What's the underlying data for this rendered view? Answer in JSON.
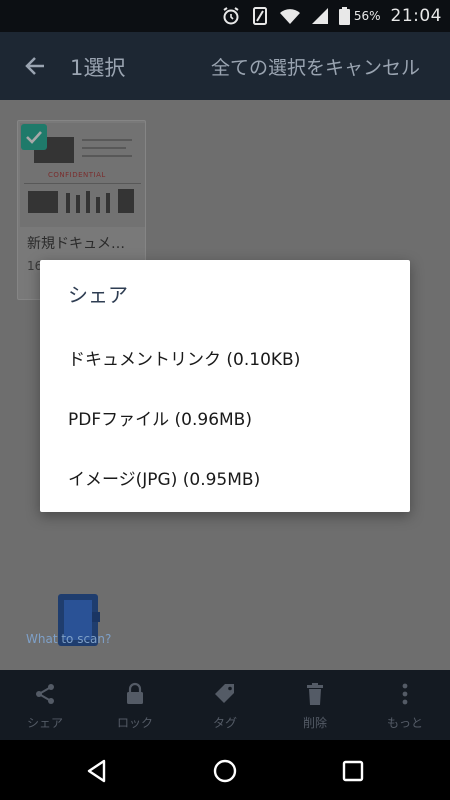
{
  "status_bar": {
    "battery_percent": "56%",
    "time": "21:04",
    "icons": [
      "alarm-icon",
      "vibrate-icon",
      "wifi-icon",
      "signal-icon",
      "battery-icon"
    ]
  },
  "app_bar": {
    "selection_count": "1選択",
    "cancel_all_label": "全ての選択をキャンセル"
  },
  "document": {
    "title": "新規ドキュメ…",
    "date": "16",
    "thumbnail_text": "CONFIDENTIAL"
  },
  "helper": {
    "label": "What to scan?"
  },
  "share_dialog": {
    "title": "シェア",
    "options": [
      "ドキュメントリンク (0.10KB)",
      "PDFファイル (0.96MB)",
      "イメージ(JPG) (0.95MB)"
    ]
  },
  "toolbar": {
    "items": [
      {
        "label": "シェア",
        "icon": "share-icon"
      },
      {
        "label": "ロック",
        "icon": "lock-icon"
      },
      {
        "label": "タグ",
        "icon": "tag-icon"
      },
      {
        "label": "削除",
        "icon": "trash-icon"
      },
      {
        "label": "もっと",
        "icon": "more-vert-icon"
      }
    ]
  },
  "colors": {
    "app_bar": "#1d2733",
    "dialog_title": "#2e3d52",
    "check_accent": "#1f7a6a",
    "toolbar_bg": "#141a22"
  }
}
